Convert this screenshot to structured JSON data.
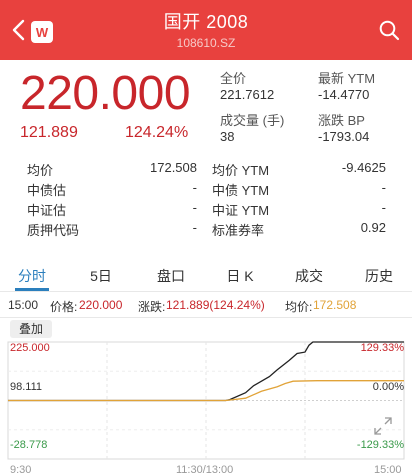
{
  "header": {
    "title": "国开 2008",
    "code": "108610.SZ",
    "logo_letter": "W",
    "color": "#e8413e"
  },
  "quote": {
    "price": "220.000",
    "change": "121.889",
    "change_pct": "124.24%",
    "full_price_label": "全价",
    "full_price": "221.7612",
    "latest_ytm_label": "最新 YTM",
    "latest_ytm": "-14.4770",
    "volume_label": "成交量 (手)",
    "volume": "38",
    "bp_label": "涨跌 BP",
    "bp": "-1793.04"
  },
  "stats": [
    {
      "label": "均价",
      "value": "172.508",
      "label2": "均价 YTM",
      "value2": "-9.4625"
    },
    {
      "label": "中债估",
      "value": "-",
      "label2": "中债 YTM",
      "value2": "-"
    },
    {
      "label": "中证估",
      "value": "-",
      "label2": "中证 YTM",
      "value2": "-"
    },
    {
      "label": "质押代码",
      "value": "-",
      "label2": "标准券率",
      "value2": "0.92"
    }
  ],
  "tabs": [
    "分时",
    "5日",
    "盘口",
    "日 K",
    "成交",
    "历史"
  ],
  "active_tab": "分时",
  "infobar": {
    "time": "15:00",
    "price_label": "价格:",
    "price": "220.000",
    "chg_label": "涨跌:",
    "chg": "121.889(124.24%)",
    "avg_label": "均价:",
    "avg": "172.508"
  },
  "overlay_label": "叠加",
  "chart_data": {
    "type": "line",
    "ylim": [
      -28.778,
      225.0
    ],
    "left_ticks": [
      "225.000",
      "98.111",
      "-28.778"
    ],
    "right_ticks": [
      "129.33%",
      "0.00%",
      "-129.33%"
    ],
    "x_ticks": [
      "9:30",
      "11:30/13:00",
      "15:00"
    ],
    "series": [
      {
        "color": "#222222",
        "points": [
          [
            0,
            98.111
          ],
          [
            0.55,
            98.111
          ],
          [
            0.56,
            100
          ],
          [
            0.6,
            115
          ],
          [
            0.62,
            130
          ],
          [
            0.66,
            150
          ],
          [
            0.68,
            165
          ],
          [
            0.71,
            185
          ],
          [
            0.73,
            200
          ],
          [
            0.75,
            203
          ],
          [
            0.76,
            218
          ],
          [
            0.77,
            225
          ],
          [
            1.0,
            225
          ]
        ]
      },
      {
        "color": "#e1a338",
        "points": [
          [
            0,
            98.111
          ],
          [
            0.55,
            98.111
          ],
          [
            0.6,
            103
          ],
          [
            0.64,
            118
          ],
          [
            0.68,
            128
          ],
          [
            0.7,
            135
          ],
          [
            0.72,
            140
          ],
          [
            0.78,
            141
          ],
          [
            1.0,
            141
          ]
        ]
      }
    ]
  }
}
